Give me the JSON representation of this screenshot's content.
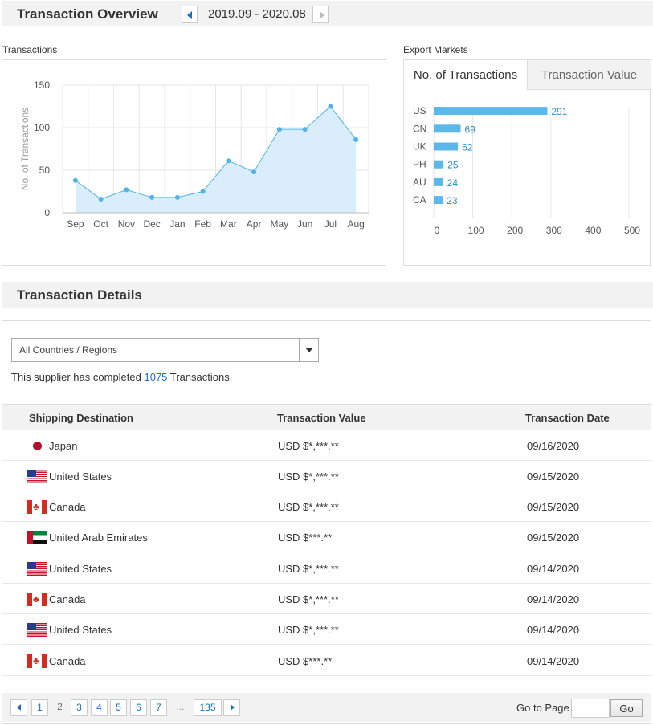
{
  "overview": {
    "title": "Transaction Overview",
    "period": "2019.09 - 2020.08"
  },
  "transactions_panel": {
    "label": "Transactions"
  },
  "export_panel": {
    "label": "Export Markets",
    "tabs": [
      {
        "label": "No. of Transactions",
        "active": true
      },
      {
        "label": "Transaction Value",
        "active": false
      }
    ]
  },
  "chart_data": [
    {
      "type": "area",
      "x": [
        "Sep",
        "Oct",
        "Nov",
        "Dec",
        "Jan",
        "Feb",
        "Mar",
        "Apr",
        "May",
        "Jun",
        "Jul",
        "Aug"
      ],
      "values": [
        38,
        16,
        27,
        18,
        18,
        25,
        61,
        48,
        98,
        98,
        125,
        86
      ],
      "ylabel": "No. of Transactions",
      "xlabel": "",
      "ylim": [
        0,
        150
      ],
      "yticks": [
        0,
        50,
        100,
        150
      ],
      "grid": true,
      "color": "#4fb3e6",
      "fill": "#d9eefa"
    },
    {
      "type": "bar",
      "orientation": "horizontal",
      "categories": [
        "US",
        "CN",
        "UK",
        "PH",
        "AU",
        "CA"
      ],
      "values": [
        291,
        69,
        62,
        25,
        24,
        23
      ],
      "xlim": [
        0,
        500
      ],
      "xticks": [
        0,
        100,
        200,
        300,
        400,
        500
      ],
      "grid": true,
      "color": "#5bb8e8",
      "label_color": "#2a8fd0"
    }
  ],
  "details": {
    "title": "Transaction Details",
    "filter": {
      "selected": "All Countries / Regions"
    },
    "summary": {
      "prefix": "This supplier has completed ",
      "count": "1075",
      "suffix": " Transactions."
    },
    "columns": [
      "Shipping Destination",
      "Transaction Value",
      "Transaction Date"
    ],
    "rows": [
      {
        "flag": "japan-flag-icon",
        "destination": "Japan",
        "value": "USD $*,***.**",
        "date": "09/16/2020"
      },
      {
        "flag": "united-states-flag-icon",
        "destination": "United States",
        "value": "USD $*,***.**",
        "date": "09/15/2020"
      },
      {
        "flag": "canada-flag-icon",
        "destination": "Canada",
        "value": "USD $*,***.**",
        "date": "09/15/2020"
      },
      {
        "flag": "uae-flag-icon",
        "destination": "United Arab Emirates",
        "value": "USD $***.**",
        "date": "09/15/2020"
      },
      {
        "flag": "united-states-flag-icon",
        "destination": "United States",
        "value": "USD $*,***.**",
        "date": "09/14/2020"
      },
      {
        "flag": "canada-flag-icon",
        "destination": "Canada",
        "value": "USD $*,***.**",
        "date": "09/14/2020"
      },
      {
        "flag": "united-states-flag-icon",
        "destination": "United States",
        "value": "USD $*,***.**",
        "date": "09/14/2020"
      },
      {
        "flag": "canada-flag-icon",
        "destination": "Canada",
        "value": "USD $***.**",
        "date": "09/14/2020"
      }
    ],
    "pagination": {
      "pages": [
        "1",
        "2",
        "3",
        "4",
        "5",
        "6",
        "7"
      ],
      "current": "2",
      "ellipsis": "...",
      "last": "135",
      "goto_label": "Go to Page",
      "go_label": "Go"
    }
  }
}
